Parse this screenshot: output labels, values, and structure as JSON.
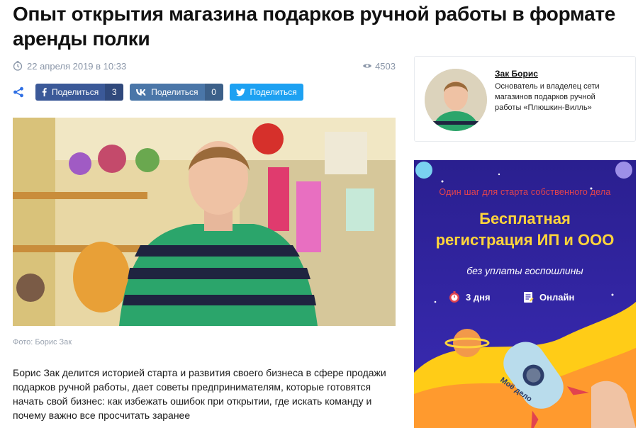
{
  "article": {
    "title": "Опыт открытия магазина подарков ручной работы в формате аренды полки",
    "date": "22 апреля 2019 в 10:33",
    "views": "4503",
    "photo_caption": "Фото: Борис Зак",
    "lead": "Борис Зак делится историей старта и развития своего бизнеса в сфере продажи подарков ручной работы, дает советы предпринимателям, которые готовятся начать свой бизнес: как избежать ошибок при открытии, где искать команду и почему важно все просчитать заранее"
  },
  "share": {
    "facebook": {
      "label": "Поделиться",
      "count": "3"
    },
    "vk": {
      "label": "Поделиться",
      "count": "0"
    },
    "twitter": {
      "label": "Поделиться"
    }
  },
  "author": {
    "name": "Зак Борис",
    "role": "Основатель и владелец сети магазинов подарков ручной работы «Плюшкин-Вилль»"
  },
  "ad": {
    "tagline": "Один шаг для старта собственного дела",
    "headline_line1": "Бесплатная",
    "headline_line2": "регистрация ИП и ООО",
    "subline": "без уплаты госпошлины",
    "feature_1": "3 дня",
    "feature_2": "Онлайн",
    "rocket_label": "Моё дело"
  },
  "colors": {
    "facebook": "#3b5998",
    "vk": "#4a76a8",
    "twitter": "#1da1f2",
    "ad_background": "#2a1f8f",
    "ad_headline": "#ffd43b",
    "ad_tagline": "#e2434e",
    "muted_text": "#8a96a8"
  },
  "icons": [
    "clock-icon",
    "eye-icon",
    "share-icon",
    "facebook-icon",
    "vk-icon",
    "twitter-icon",
    "timer-icon",
    "document-icon"
  ]
}
